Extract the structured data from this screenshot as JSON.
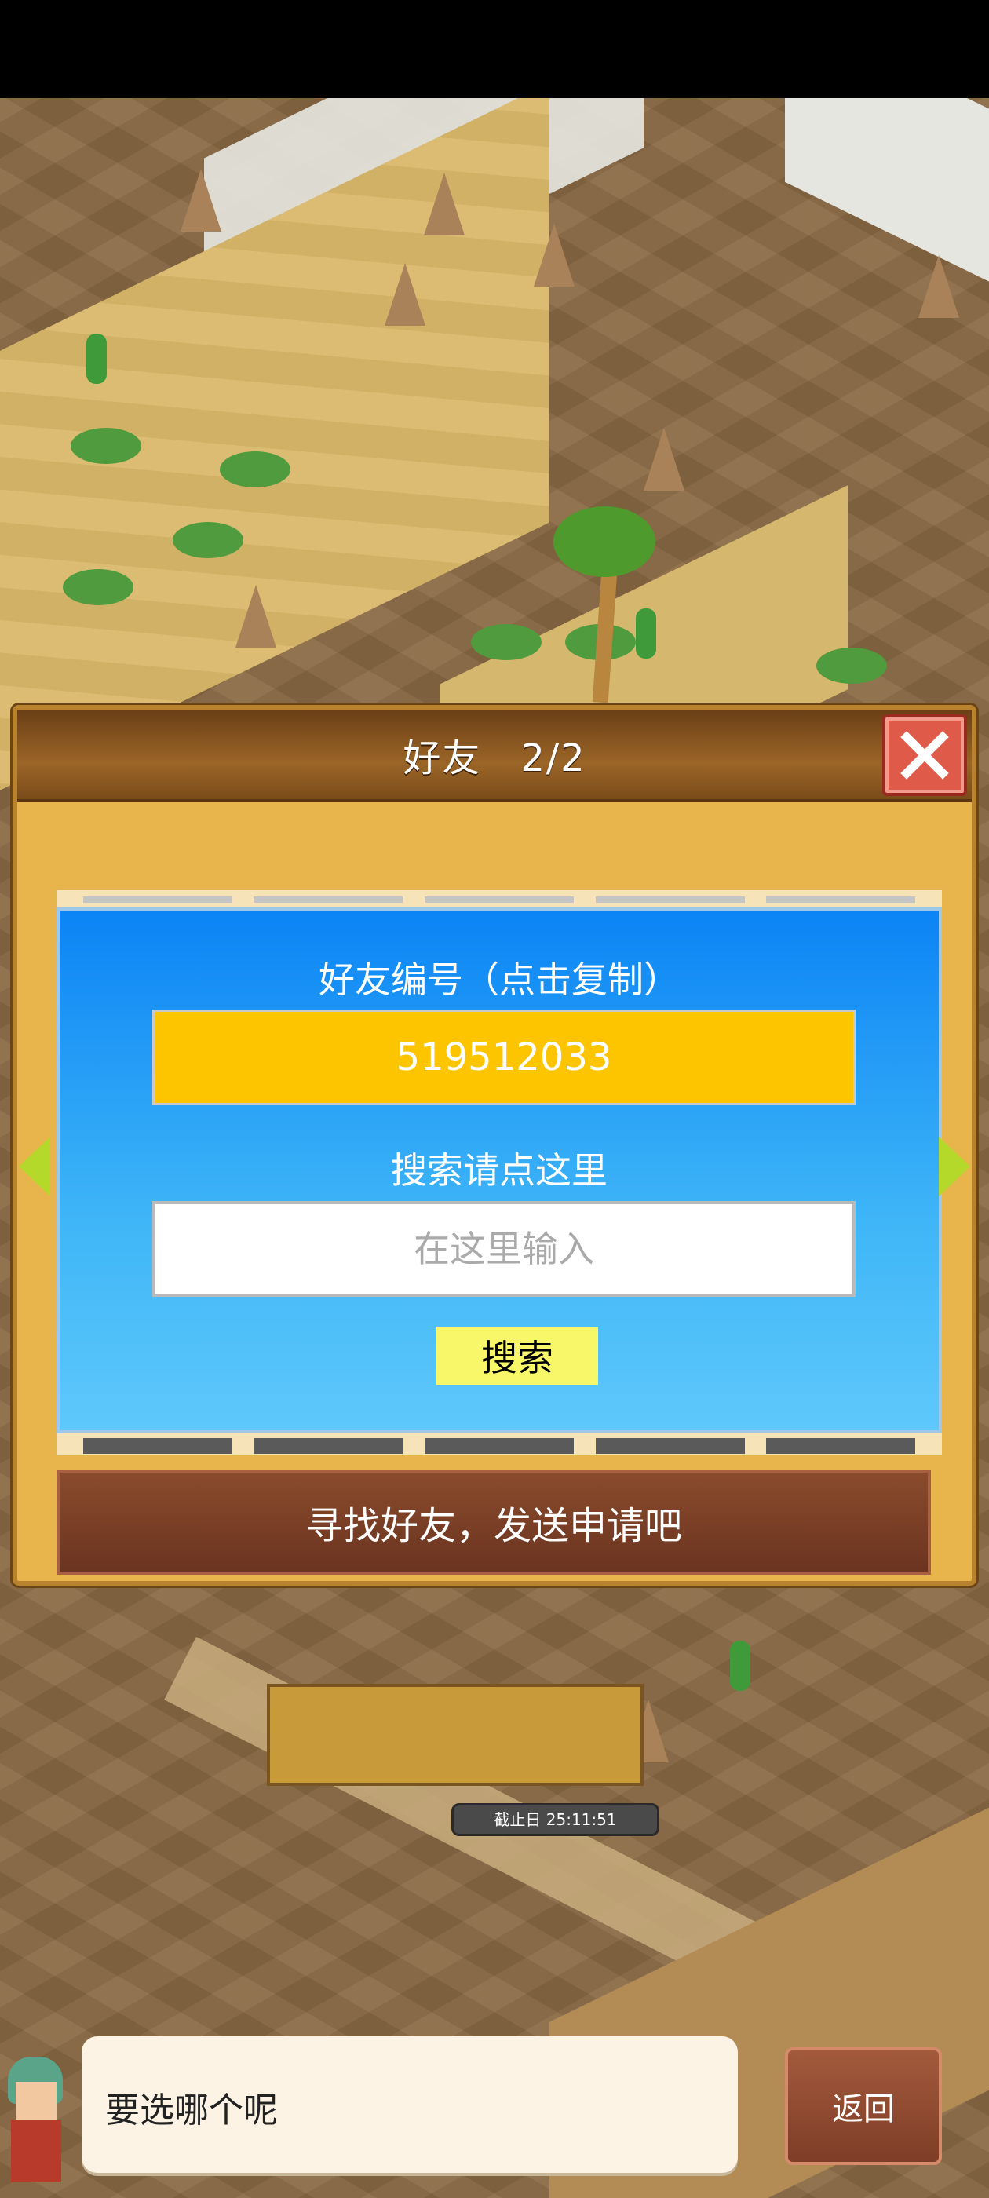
{
  "dialog": {
    "title": "好友　2/2",
    "friend_code_label": "好友编号（点击复制）",
    "friend_code": "519512033",
    "search_label": "搜索请点这里",
    "search_placeholder": "在这里输入",
    "search_button": "搜索",
    "find_friends_button": "寻找好友，发送申请吧"
  },
  "map": {
    "deadline_badge": "截止日 25:11:51"
  },
  "bottom": {
    "speech_text": "要选哪个呢",
    "back_button": "返回"
  },
  "colors": {
    "friend_code_bg": "#fdc400",
    "search_button_bg": "#f8f76a",
    "close_button": "#e05a4a",
    "panel_blue": "#0b84f5"
  },
  "icons": {
    "close": "close-icon",
    "prev": "arrow-left-icon",
    "next": "arrow-right-icon"
  }
}
